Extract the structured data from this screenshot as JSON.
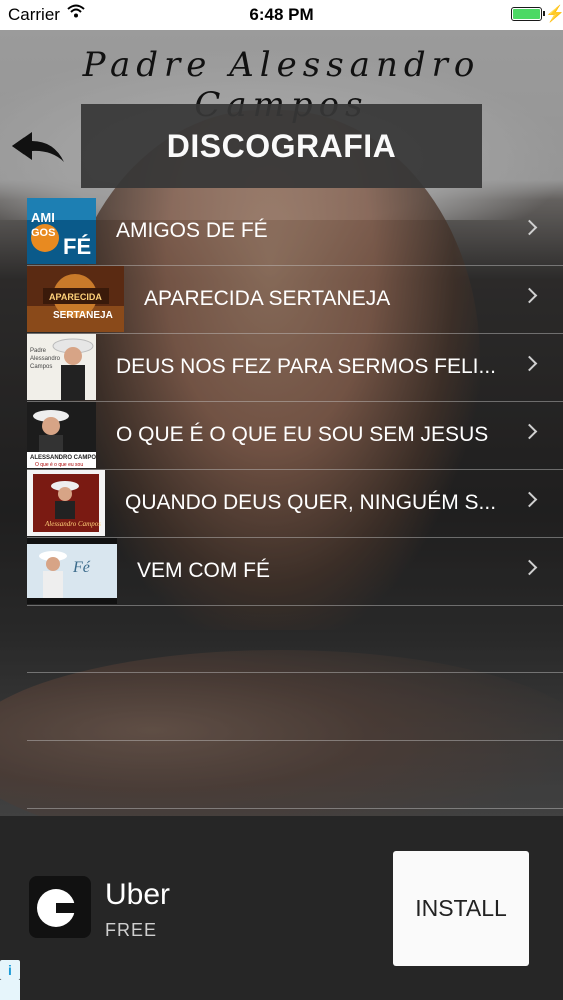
{
  "status_bar": {
    "carrier": "Carrier",
    "time": "6:48 PM",
    "battery_color": "#4cd964"
  },
  "header": {
    "app_title": "Padre Alessandro Campos",
    "back_icon": "double-arrow-back-icon",
    "section_title": "DISCOGRAFIA"
  },
  "albums": [
    {
      "title": "AMIGOS DE FÉ",
      "cover": "album-cover-amigos-de-fe"
    },
    {
      "title": "APARECIDA SERTANEJA",
      "cover": "album-cover-aparecida-sertaneja"
    },
    {
      "title": "DEUS NOS FEZ PARA SERMOS FELI...",
      "cover": "album-cover-deus-nos-fez"
    },
    {
      "title": "O QUE É O QUE EU SOU SEM JESUS",
      "cover": "album-cover-o-que-e"
    },
    {
      "title": "QUANDO DEUS QUER, NINGUÉM S...",
      "cover": "album-cover-quando-deus-quer"
    },
    {
      "title": "VEM COM FÉ",
      "cover": "album-cover-vem-com-fe"
    }
  ],
  "ad": {
    "app_name": "Uber",
    "price": "FREE",
    "install_label": "INSTALL",
    "info_glyph": "i"
  }
}
